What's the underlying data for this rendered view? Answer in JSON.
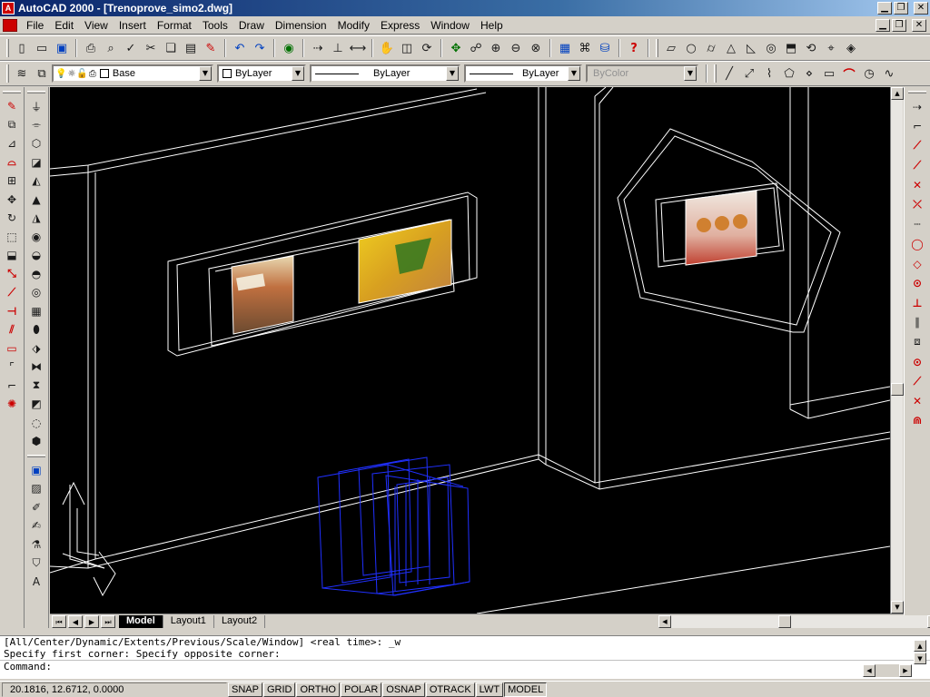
{
  "window": {
    "title": "AutoCAD 2000 - [Trenoprove_simo2.dwg]",
    "app_icon": "autocad-logo"
  },
  "menu": [
    "File",
    "Edit",
    "View",
    "Insert",
    "Format",
    "Tools",
    "Draw",
    "Dimension",
    "Modify",
    "Express",
    "Window",
    "Help"
  ],
  "layer_bar": {
    "layer": "Base",
    "color": "ByLayer",
    "linetype": "ByLayer",
    "lineweight": "ByLayer",
    "plotstyle": "ByColor"
  },
  "tabs": [
    "Model",
    "Layout1",
    "Layout2"
  ],
  "command": {
    "history_1": "[All/Center/Dynamic/Extents/Previous/Scale/Window] <real time>: _w",
    "history_2": "Specify first corner: Specify opposite corner:",
    "prompt": "Command:"
  },
  "status": {
    "coords": "20.1816, 12.6712, 0.0000",
    "toggles": [
      "SNAP",
      "GRID",
      "ORTHO",
      "POLAR",
      "OSNAP",
      "OTRACK",
      "LWT",
      "MODEL"
    ]
  },
  "colors": {
    "drawing_bg": "#000000",
    "wire": "#ffffff",
    "selection_blue": "#2030ff",
    "titlebar": "#0a246a"
  }
}
